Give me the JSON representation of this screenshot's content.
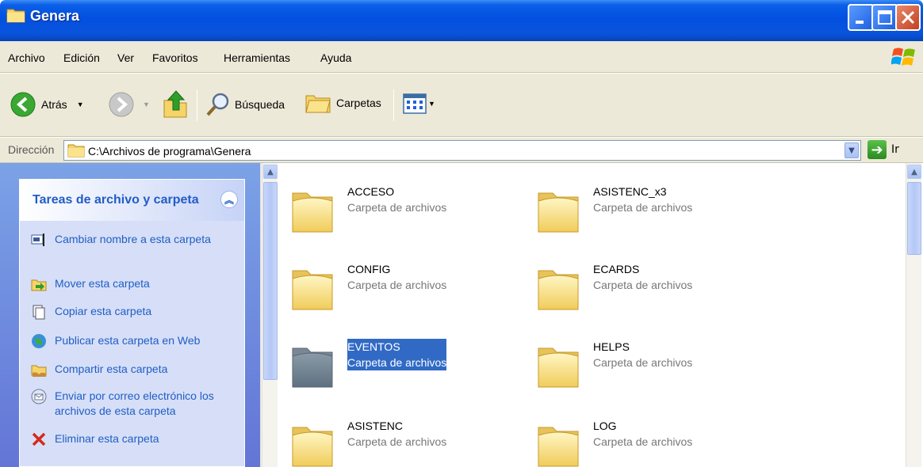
{
  "window": {
    "title": "Genera",
    "title_icon": "folder-icon"
  },
  "menu": {
    "items": [
      "Archivo",
      "Edición",
      "Ver",
      "Favoritos",
      "Herramientas",
      "Ayuda"
    ]
  },
  "toolbar": {
    "back_label": "Atrás",
    "search_label": "Búsqueda",
    "folders_label": "Carpetas"
  },
  "address": {
    "label": "Dirección",
    "path": "C:\\Archivos de programa\\Genera",
    "go_label": "Ir"
  },
  "tasks": {
    "title": "Tareas de archivo y carpeta",
    "items": [
      {
        "label": "Cambiar nombre a esta carpeta",
        "icon": "rename-icon"
      },
      {
        "label": "Mover esta carpeta",
        "icon": "move-icon"
      },
      {
        "label": "Copiar esta carpeta",
        "icon": "copy-icon"
      },
      {
        "label": "Publicar esta carpeta en Web",
        "icon": "publish-web-icon"
      },
      {
        "label": "Compartir esta carpeta",
        "icon": "share-icon"
      },
      {
        "label": "Enviar por correo electrónico los archivos de esta carpeta",
        "icon": "email-icon"
      },
      {
        "label": "Eliminar esta carpeta",
        "icon": "delete-icon"
      }
    ]
  },
  "files": [
    {
      "name": "ACCESO",
      "type": "Carpeta de archivos",
      "selected": false
    },
    {
      "name": "ASISTENC_x3",
      "type": "Carpeta de archivos",
      "selected": false
    },
    {
      "name": "CONFIG",
      "type": "Carpeta de archivos",
      "selected": false
    },
    {
      "name": "ECARDS",
      "type": "Carpeta de archivos",
      "selected": false
    },
    {
      "name": "EVENTOS",
      "type": "Carpeta de archivos",
      "selected": true
    },
    {
      "name": "HELPS",
      "type": "Carpeta de archivos",
      "selected": false
    },
    {
      "name": "ASISTENC",
      "type": "Carpeta de archivos",
      "selected": false
    },
    {
      "name": "LOG",
      "type": "Carpeta de archivos",
      "selected": false
    }
  ],
  "colors": {
    "titlebar": "#0350e0",
    "task_link": "#215dc6",
    "selection": "#316ac5"
  }
}
